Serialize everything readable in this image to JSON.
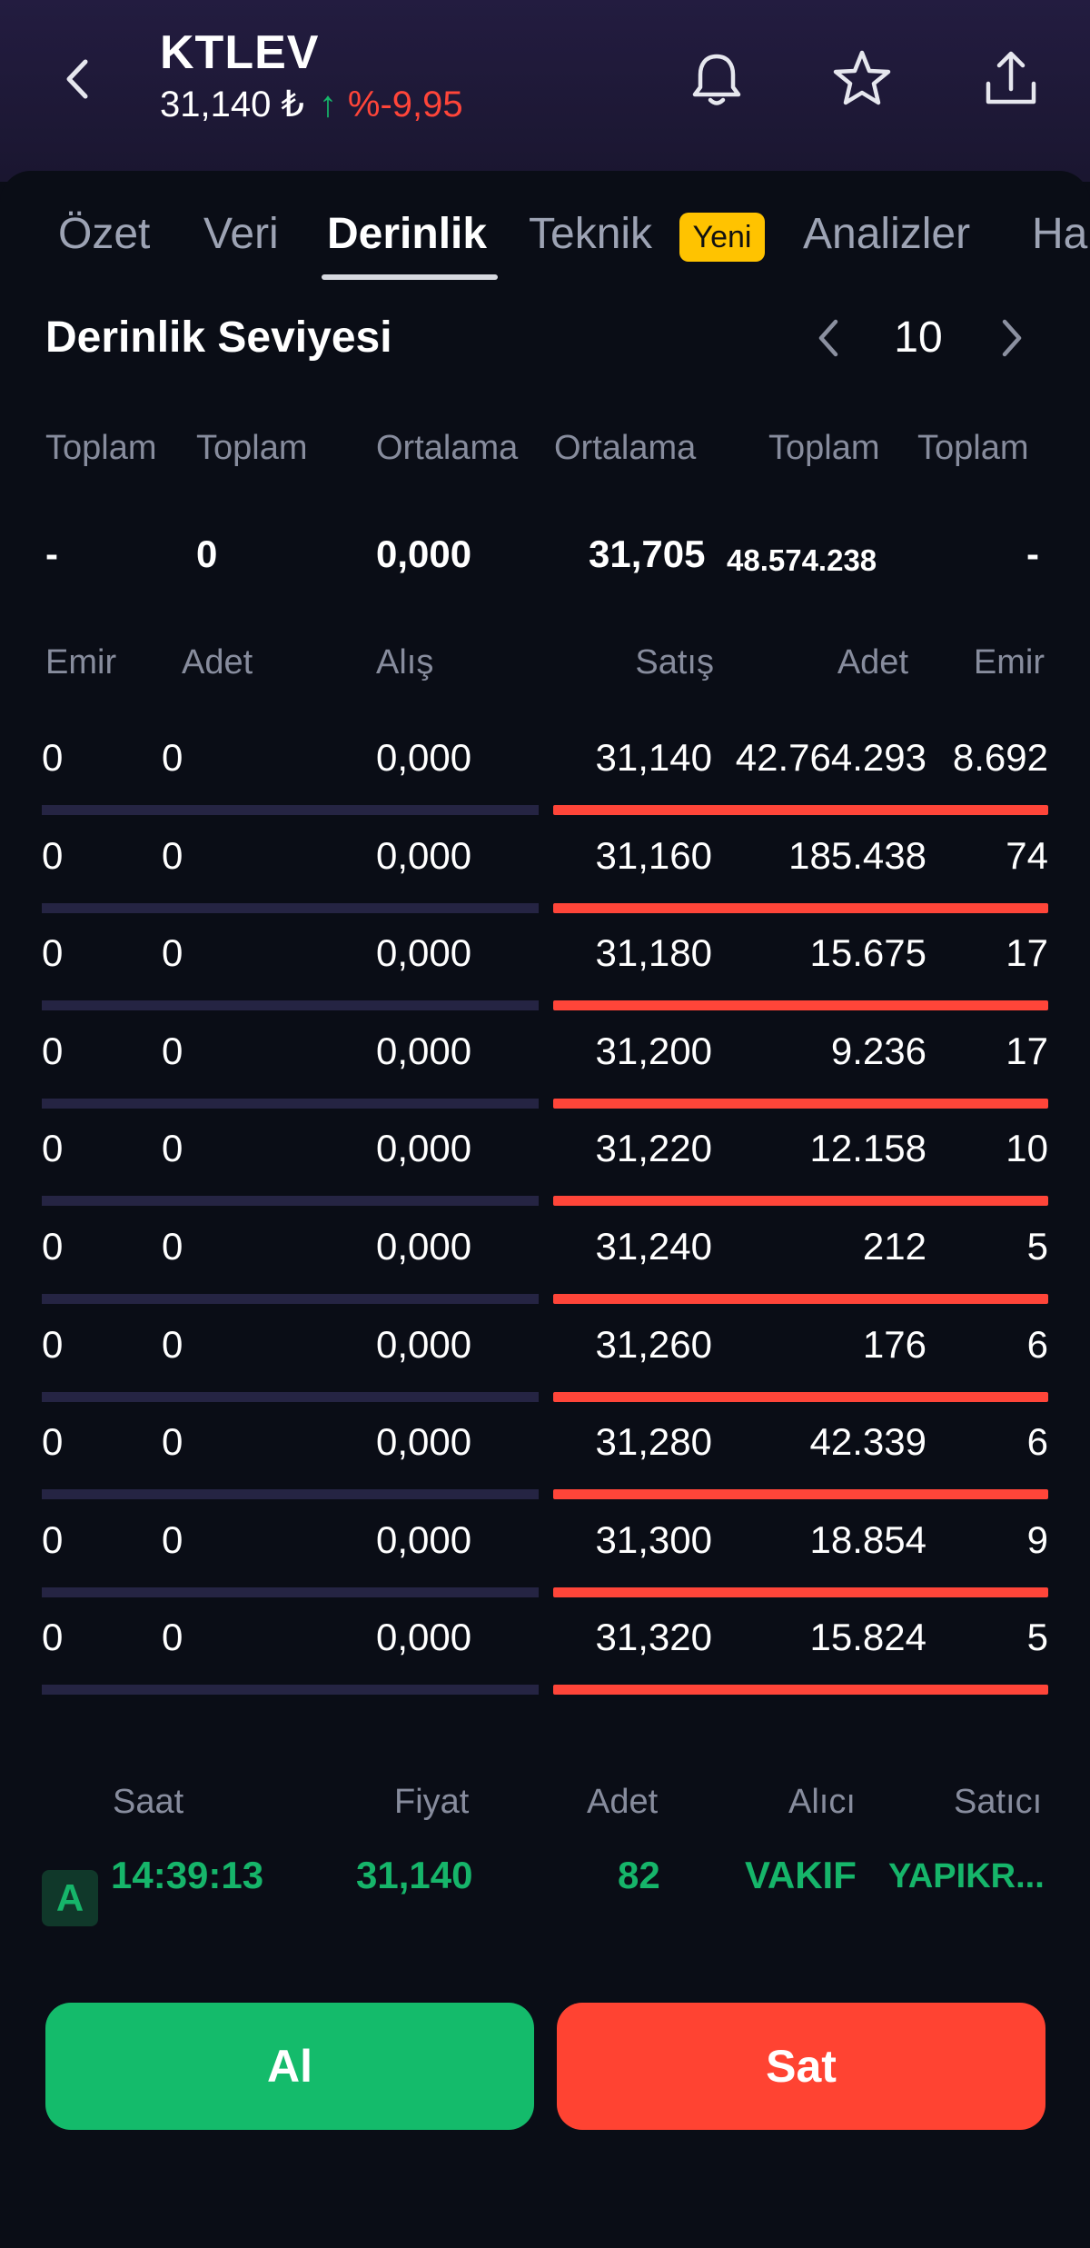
{
  "header": {
    "ticker": "KTLEV",
    "price": "31,140 ₺",
    "change_pct": "%-9,95"
  },
  "tabs": [
    "Özet",
    "Veri",
    "Derinlik",
    "Teknik",
    "Analizler",
    "Ha"
  ],
  "new_badge": "Yeni",
  "depth": {
    "title": "Derinlik Seviyesi",
    "level": "10",
    "summary_headers": [
      "Toplam",
      "Toplam",
      "Ortalama",
      "Ortalama",
      "Toplam",
      "Toplam"
    ],
    "summary_values": [
      "-",
      "0",
      "0,000",
      "31,705",
      "48.574.238",
      "-"
    ],
    "col_headers": [
      "Emir",
      "Adet",
      "Alış",
      "Satış",
      "Adet",
      "Emir"
    ],
    "rows": [
      {
        "buy_orders": "0",
        "buy_qty": "0",
        "bid": "0,000",
        "ask": "31,140",
        "sell_qty": "42.764.293",
        "sell_orders": "8.692",
        "sell_fill": 1.0
      },
      {
        "buy_orders": "0",
        "buy_qty": "0",
        "bid": "0,000",
        "ask": "31,160",
        "sell_qty": "185.438",
        "sell_orders": "74",
        "sell_fill": 1.0
      },
      {
        "buy_orders": "0",
        "buy_qty": "0",
        "bid": "0,000",
        "ask": "31,180",
        "sell_qty": "15.675",
        "sell_orders": "17",
        "sell_fill": 1.0
      },
      {
        "buy_orders": "0",
        "buy_qty": "0",
        "bid": "0,000",
        "ask": "31,200",
        "sell_qty": "9.236",
        "sell_orders": "17",
        "sell_fill": 1.0
      },
      {
        "buy_orders": "0",
        "buy_qty": "0",
        "bid": "0,000",
        "ask": "31,220",
        "sell_qty": "12.158",
        "sell_orders": "10",
        "sell_fill": 1.0
      },
      {
        "buy_orders": "0",
        "buy_qty": "0",
        "bid": "0,000",
        "ask": "31,240",
        "sell_qty": "212",
        "sell_orders": "5",
        "sell_fill": 1.0
      },
      {
        "buy_orders": "0",
        "buy_qty": "0",
        "bid": "0,000",
        "ask": "31,260",
        "sell_qty": "176",
        "sell_orders": "6",
        "sell_fill": 1.0
      },
      {
        "buy_orders": "0",
        "buy_qty": "0",
        "bid": "0,000",
        "ask": "31,280",
        "sell_qty": "42.339",
        "sell_orders": "6",
        "sell_fill": 1.0
      },
      {
        "buy_orders": "0",
        "buy_qty": "0",
        "bid": "0,000",
        "ask": "31,300",
        "sell_qty": "18.854",
        "sell_orders": "9",
        "sell_fill": 1.0
      },
      {
        "buy_orders": "0",
        "buy_qty": "0",
        "bid": "0,000",
        "ask": "31,320",
        "sell_qty": "15.824",
        "sell_orders": "5",
        "sell_fill": 1.0
      }
    ]
  },
  "trades": {
    "headers": [
      "Saat",
      "Fiyat",
      "Adet",
      "Alıcı",
      "Satıcı"
    ],
    "last": {
      "side": "A",
      "time": "14:39:13",
      "price": "31,140",
      "qty": "82",
      "buyer": "VAKIF",
      "seller": "YAPIKR..."
    }
  },
  "actions": {
    "buy": "Al",
    "sell": "Sat"
  },
  "colors": {
    "up": "#16b56a",
    "down": "#ff4539",
    "buy_button": "#14bb6b",
    "sell_button": "#ff4332",
    "badge": "#ffc300"
  },
  "icons": [
    "back-arrow-icon",
    "arrow-up-icon",
    "bell-icon",
    "star-icon",
    "share-icon",
    "chevron-left-icon",
    "chevron-right-icon"
  ]
}
